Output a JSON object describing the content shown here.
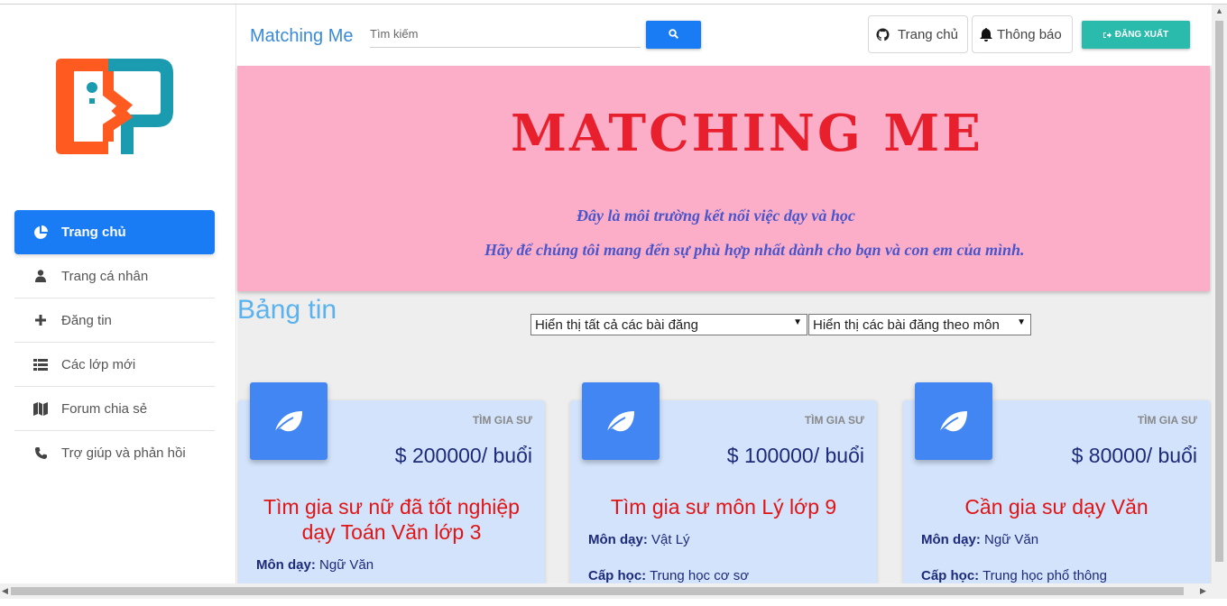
{
  "header": {
    "brand": "Matching Me",
    "search_placeholder": "Tìm kiếm",
    "home_button": "Trang chủ",
    "notify_button": "Thông báo",
    "logout_button": "ĐĂNG XUẤT"
  },
  "sidebar": {
    "items": [
      {
        "label": "Trang chủ",
        "icon": "pie-chart-icon",
        "active": true
      },
      {
        "label": "Trang cá nhân",
        "icon": "user-icon"
      },
      {
        "label": "Đăng tin",
        "icon": "plus-icon"
      },
      {
        "label": "Các lớp mới",
        "icon": "list-icon"
      },
      {
        "label": "Forum chia sẻ",
        "icon": "map-icon"
      },
      {
        "label": "Trợ giúp và phản hồi",
        "icon": "phone-icon"
      }
    ]
  },
  "hero": {
    "title": "MATCHING ME",
    "line1": "Đây là môi trường kết nối việc dạy và học",
    "line2": "Hãy để chúng tôi mang đến sự phù hợp nhất dành cho bạn và con em của mình."
  },
  "feed": {
    "title": "Bảng tin",
    "filter_all": "Hiển thị tất cả các bài đăng",
    "filter_subject": "Hiển thị các bài đăng theo môn"
  },
  "posts": [
    {
      "category": "TÌM GIA SƯ",
      "price": "$ 200000/ buổi",
      "title": "Tìm gia sư nữ đã tốt nghiệp dạy Toán Văn lớp 3",
      "subject_label": "Môn dạy:",
      "subject": "Ngữ Văn"
    },
    {
      "category": "TÌM GIA SƯ",
      "price": "$ 100000/ buổi",
      "title": "Tìm gia sư môn Lý lớp 9",
      "subject_label": "Môn dạy:",
      "subject": "Vật Lý",
      "level_label": "Cấp học:",
      "level": "Trung học cơ sơ"
    },
    {
      "category": "TÌM GIA SƯ",
      "price": "$ 80000/ buổi",
      "title": "Cần gia sư dạy Văn",
      "subject_label": "Môn dạy:",
      "subject": "Ngữ Văn",
      "level_label": "Cấp học:",
      "level": "Trung học phổ thông"
    }
  ],
  "colors": {
    "accent": "#1a7cf5",
    "hero_bg": "#fcaec9",
    "hero_title": "#e8202d",
    "logout": "#2bbbad",
    "card_bg": "#d3e3fb",
    "card_icon": "#4286f4"
  }
}
